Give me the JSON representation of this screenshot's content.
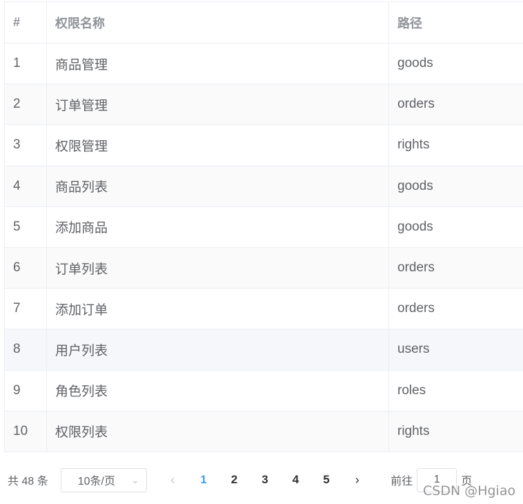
{
  "table": {
    "headers": [
      "#",
      "权限名称",
      "路径"
    ],
    "rows": [
      {
        "idx": "1",
        "name": "商品管理",
        "path": "goods"
      },
      {
        "idx": "2",
        "name": "订单管理",
        "path": "orders"
      },
      {
        "idx": "3",
        "name": "权限管理",
        "path": "rights"
      },
      {
        "idx": "4",
        "name": "商品列表",
        "path": "goods"
      },
      {
        "idx": "5",
        "name": "添加商品",
        "path": "goods"
      },
      {
        "idx": "6",
        "name": "订单列表",
        "path": "orders"
      },
      {
        "idx": "7",
        "name": "添加订单",
        "path": "orders"
      },
      {
        "idx": "8",
        "name": "用户列表",
        "path": "users"
      },
      {
        "idx": "9",
        "name": "角色列表",
        "path": "roles"
      },
      {
        "idx": "10",
        "name": "权限列表",
        "path": "rights"
      }
    ]
  },
  "pagination": {
    "total_label": "共 48 条",
    "page_size": "10条/页",
    "prev_icon": "‹",
    "next_icon": "›",
    "pages": [
      "1",
      "2",
      "3",
      "4",
      "5"
    ],
    "current_page": "1",
    "goto_prefix": "前往",
    "goto_value": "1",
    "goto_suffix": "页",
    "active_color": "#409eff"
  },
  "watermark": "CSDN @Hgiao"
}
